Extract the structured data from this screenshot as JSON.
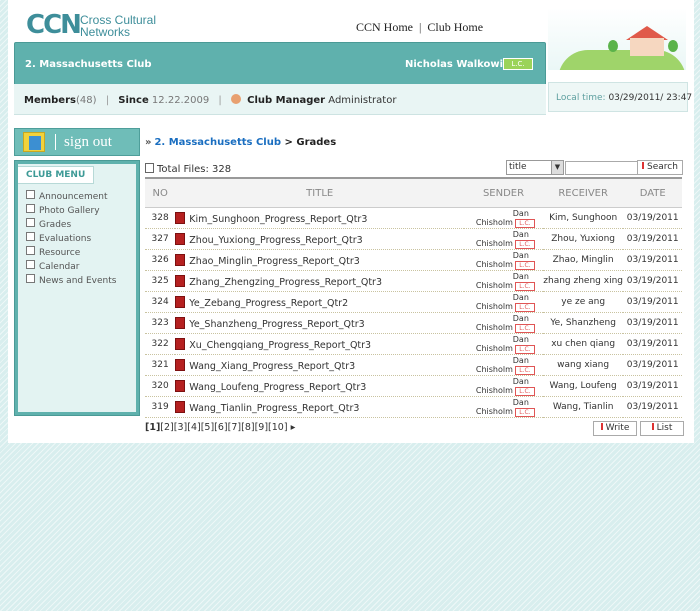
{
  "logo": {
    "mark": "CCN",
    "name_line1": "Cross Cultural",
    "name_line2": "Networks"
  },
  "topnav": {
    "home": "CCN Home",
    "separator": "|",
    "club_home": "Club Home"
  },
  "club": {
    "name": "2. Massachusetts Club",
    "user_name": "Nicholas Walkowicz",
    "user_badge": "L.C."
  },
  "stats": {
    "members_label": "Members",
    "members_count": "(48)",
    "since_label": "Since",
    "since_value": "12.22.2009",
    "manager_label": "Club Manager",
    "manager_value": "Administrator"
  },
  "localtime": {
    "label": "Local time:",
    "value": "03/29/2011/ 23:47"
  },
  "signout": {
    "label": "sign out"
  },
  "menu": {
    "title": "CLUB MENU",
    "items": [
      "Announcement",
      "Photo Gallery",
      "Grades",
      "Evaluations",
      "Resource",
      "Calendar",
      "News and Events"
    ]
  },
  "breadcrumb": {
    "club": "2. Massachusetts Club",
    "separator": ">",
    "page": "Grades"
  },
  "totals": {
    "label": "Total Files:",
    "count": "328"
  },
  "search": {
    "field": "title",
    "query": "",
    "button": "Search"
  },
  "table": {
    "headers": [
      "NO",
      "TITLE",
      "SENDER",
      "RECEIVER",
      "DATE"
    ],
    "rows": [
      {
        "no": "328",
        "title": "Kim_Sunghoon_Progress_Report_Qtr3",
        "sender_first": "Dan",
        "sender_last": "Chisholm",
        "sender_badge": "L.C.",
        "receiver": "Kim, Sunghoon",
        "date": "03/19/2011"
      },
      {
        "no": "327",
        "title": "Zhou_Yuxiong_Progress_Report_Qtr3",
        "sender_first": "Dan",
        "sender_last": "Chisholm",
        "sender_badge": "L.C.",
        "receiver": "Zhou, Yuxiong",
        "date": "03/19/2011"
      },
      {
        "no": "326",
        "title": "Zhao_Minglin_Progress_Report_Qtr3",
        "sender_first": "Dan",
        "sender_last": "Chisholm",
        "sender_badge": "L.C.",
        "receiver": "Zhao, Minglin",
        "date": "03/19/2011"
      },
      {
        "no": "325",
        "title": "Zhang_Zhengzing_Progress_Report_Qtr3",
        "sender_first": "Dan",
        "sender_last": "Chisholm",
        "sender_badge": "L.C.",
        "receiver": "zhang zheng xing",
        "date": "03/19/2011"
      },
      {
        "no": "324",
        "title": "Ye_Zebang_Progress_Report_Qtr2",
        "sender_first": "Dan",
        "sender_last": "Chisholm",
        "sender_badge": "L.C.",
        "receiver": "ye ze ang",
        "date": "03/19/2011"
      },
      {
        "no": "323",
        "title": "Ye_Shanzheng_Progress_Report_Qtr3",
        "sender_first": "Dan",
        "sender_last": "Chisholm",
        "sender_badge": "L.C.",
        "receiver": "Ye, Shanzheng",
        "date": "03/19/2011"
      },
      {
        "no": "322",
        "title": "Xu_Chengqiang_Progress_Report_Qtr3",
        "sender_first": "Dan",
        "sender_last": "Chisholm",
        "sender_badge": "L.C.",
        "receiver": "xu chen qiang",
        "date": "03/19/2011"
      },
      {
        "no": "321",
        "title": "Wang_Xiang_Progress_Report_Qtr3",
        "sender_first": "Dan",
        "sender_last": "Chisholm",
        "sender_badge": "L.C.",
        "receiver": "wang xiang",
        "date": "03/19/2011"
      },
      {
        "no": "320",
        "title": "Wang_Loufeng_Progress_Report_Qtr3",
        "sender_first": "Dan",
        "sender_last": "Chisholm",
        "sender_badge": "L.C.",
        "receiver": "Wang, Loufeng",
        "date": "03/19/2011"
      },
      {
        "no": "319",
        "title": "Wang_Tianlin_Progress_Report_Qtr3",
        "sender_first": "Dan",
        "sender_last": "Chisholm",
        "sender_badge": "L.C.",
        "receiver": "Wang, Tianlin",
        "date": "03/19/2011"
      }
    ]
  },
  "pager": {
    "current": "[1]",
    "pages": [
      "[2]",
      "[3]",
      "[4]",
      "[5]",
      "[6]",
      "[7]",
      "[8]",
      "[9]",
      "[10]"
    ],
    "next": "▸"
  },
  "actions": {
    "write": "Write",
    "list": "List"
  },
  "icons": {
    "menu_item": "document-icon",
    "file": "pdf-file-icon",
    "signout": "books-icon",
    "manager": "person-icon"
  }
}
